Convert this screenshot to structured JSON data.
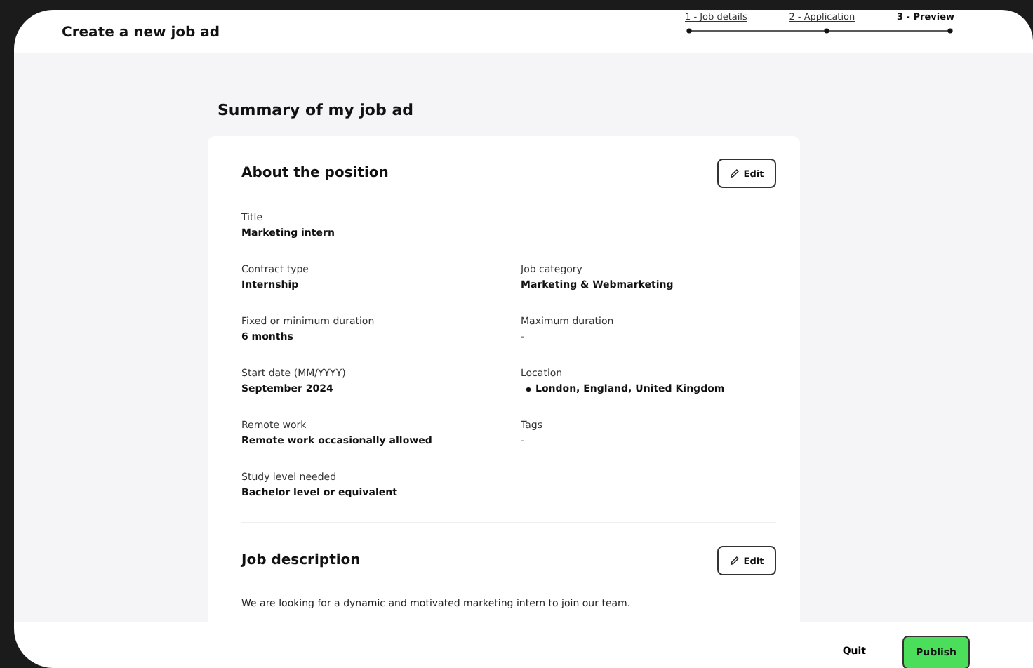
{
  "header": {
    "title": "Create a new job ad"
  },
  "steps": [
    {
      "label": "1 - Job details",
      "selected": false
    },
    {
      "label": "2 - Application",
      "selected": false
    },
    {
      "label": "3 - Preview",
      "selected": true
    }
  ],
  "page_title": "Summary of my job ad",
  "sections": [
    {
      "title": "About the position",
      "edit_label": "Edit",
      "rows": [
        [
          {
            "label": "Title",
            "value": "Marketing intern",
            "kind": "text"
          }
        ],
        [
          {
            "label": "Contract type",
            "value": "Internship",
            "kind": "text"
          },
          {
            "label": "Job category",
            "value": "Marketing & Webmarketing",
            "kind": "text"
          }
        ],
        [
          {
            "label": "Fixed or minimum duration",
            "value": "6 months",
            "kind": "text"
          },
          {
            "label": "Maximum duration",
            "value": "-",
            "kind": "empty"
          }
        ],
        [
          {
            "label": "Start date (MM/YYYY)",
            "value": "September 2024",
            "kind": "text"
          },
          {
            "label": "Location",
            "value": "London, England, United Kingdom",
            "kind": "list"
          }
        ],
        [
          {
            "label": "Remote work",
            "value": "Remote work occasionally allowed",
            "kind": "text"
          },
          {
            "label": "Tags",
            "value": "-",
            "kind": "empty"
          }
        ],
        [
          {
            "label": "Study level needed",
            "value": "Bachelor level or equivalent",
            "kind": "text"
          }
        ]
      ]
    },
    {
      "title": "Job description",
      "edit_label": "Edit",
      "text": "We are looking for a dynamic and motivated marketing intern to join our team."
    }
  ],
  "footer": {
    "quit": "Quit",
    "publish": "Publish"
  }
}
